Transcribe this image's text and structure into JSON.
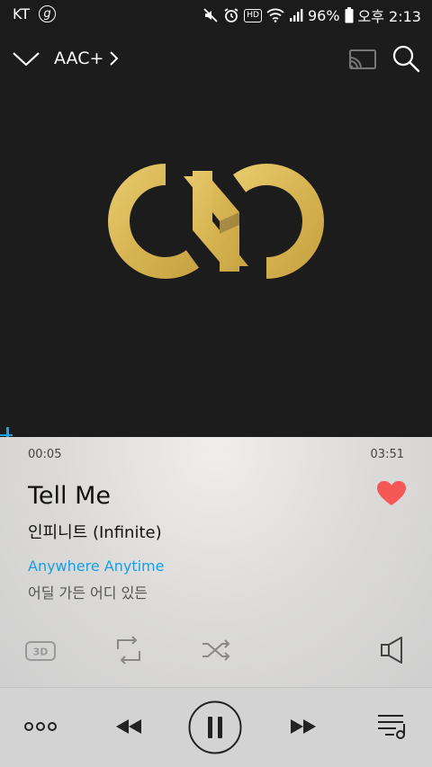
{
  "status_bar": {
    "carrier": "KT",
    "carrier_icon_letter": "g",
    "hd_label": "HD",
    "battery": "96%",
    "time": "오후 2:13"
  },
  "top_bar": {
    "format_label": "AAC+"
  },
  "player": {
    "current_time": "00:05",
    "total_time": "03:51",
    "progress_fraction": 0.02,
    "title": "Tell Me",
    "artist": "인피니트 (Infinite)",
    "liked": true,
    "lyric_current": "Anywhere Anytime",
    "lyric_next": "어딜 가든 어디 있든",
    "btn_3d_label": "3D"
  },
  "colors": {
    "accent": "#1aa3e8",
    "heart": "#f55656",
    "logo_gold": "#d9b856",
    "art_bg": "#1c1c1c"
  },
  "icons": [
    "collapse-chevron-icon",
    "chevron-right-icon",
    "cast-icon",
    "search-icon",
    "heart-icon",
    "3d-icon",
    "repeat-icon",
    "shuffle-icon",
    "sound-output-icon",
    "more-icon",
    "previous-icon",
    "pause-icon",
    "next-icon",
    "queue-icon"
  ]
}
